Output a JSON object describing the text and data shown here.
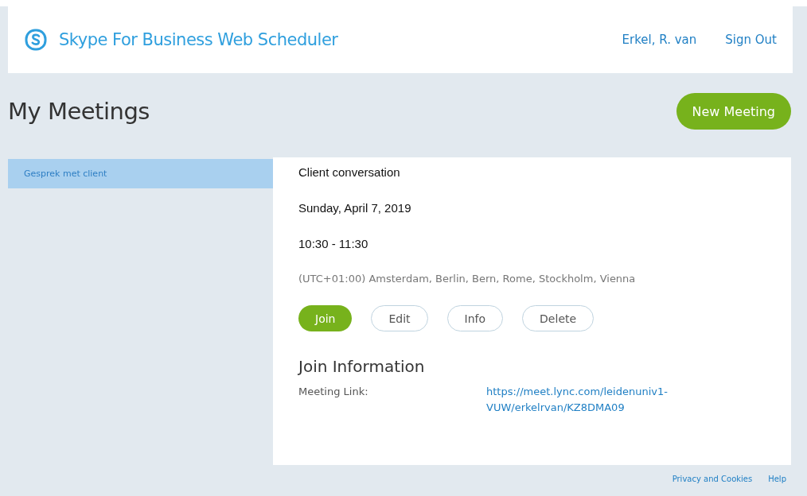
{
  "header": {
    "app_title": "Skype For Business Web Scheduler",
    "user": "Erkel, R. van",
    "sign_out": "Sign Out"
  },
  "page_title": "My Meetings",
  "new_meeting": "New Meeting",
  "meetings": [
    {
      "label": "Gesprek met client",
      "selected": true
    }
  ],
  "detail": {
    "subject": "Client conversation",
    "date": "Sunday, April 7, 2019",
    "time": "10:30 - 11:30",
    "timezone": "(UTC+01:00) Amsterdam, Berlin, Bern, Rome, Stockholm, Vienna",
    "actions": [
      {
        "label": "Join",
        "primary": true
      },
      {
        "label": "Edit",
        "primary": false
      },
      {
        "label": "Info",
        "primary": false
      },
      {
        "label": "Delete",
        "primary": false
      }
    ],
    "join_heading": "Join Information",
    "link_label": "Meeting Link:",
    "link": "https://meet.lync.com/leidenuniv1-VUW/erkelrvan/KZ8DMA09"
  },
  "footer": [
    "Privacy and Cookies",
    "Help"
  ]
}
